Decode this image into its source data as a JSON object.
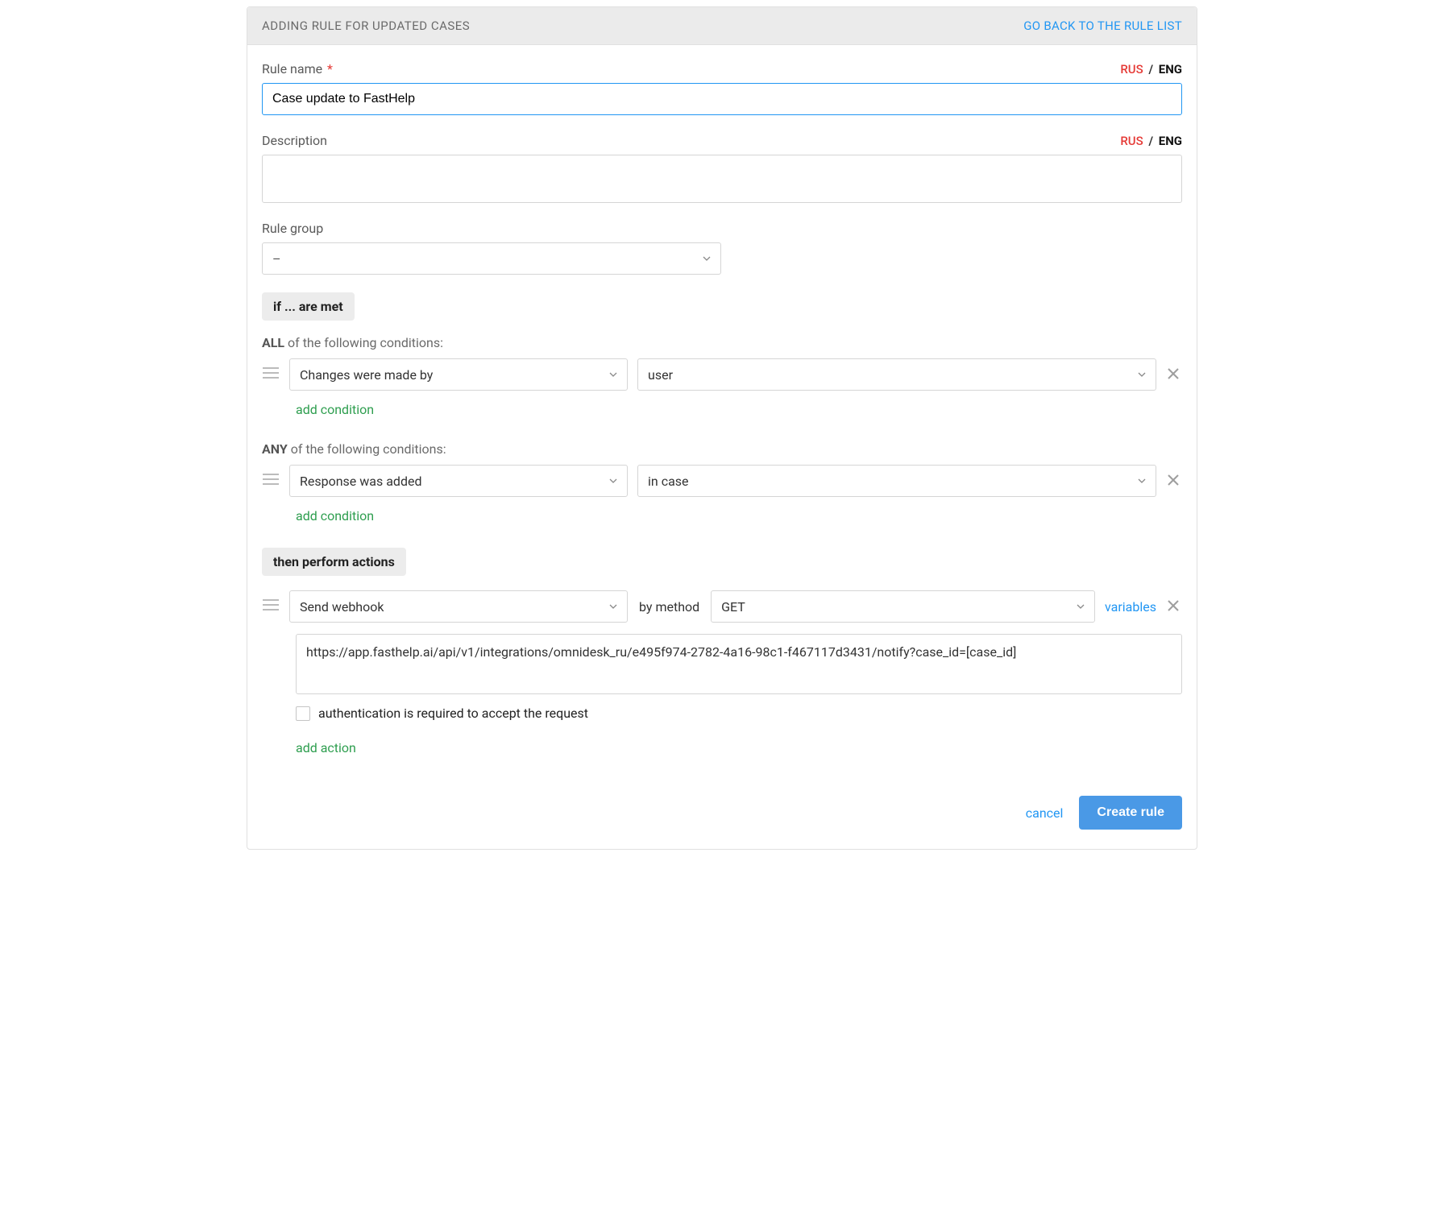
{
  "header": {
    "title": "ADDING RULE FOR UPDATED CASES",
    "back_link": "GO BACK TO THE RULE LIST"
  },
  "lang": {
    "rus": "RUS",
    "sep": "/",
    "eng": "ENG"
  },
  "fields": {
    "rule_name_label": "Rule name",
    "rule_name_value": "Case update to FastHelp",
    "description_label": "Description",
    "description_value": "",
    "rule_group_label": "Rule group",
    "rule_group_value": "–"
  },
  "sections": {
    "if_label": "if ... are met",
    "then_label": "then perform actions"
  },
  "conditions": {
    "all_prefix": "ALL",
    "all_suffix": " of the following conditions:",
    "any_prefix": "ANY",
    "any_suffix": " of the following conditions:",
    "all_rows": [
      {
        "left": "Changes were made by",
        "right": "user"
      }
    ],
    "any_rows": [
      {
        "left": "Response was added",
        "right": "in case"
      }
    ],
    "add_condition": "add condition"
  },
  "actions": {
    "rows": [
      {
        "action": "Send webhook",
        "by_method_label": "by method",
        "method": "GET",
        "variables_link": "variables",
        "url": "https://app.fasthelp.ai/api/v1/integrations/omnidesk_ru/e495f974-2782-4a16-98c1-f467117d3431/notify?case_id=[case_id]",
        "auth_required_label": "authentication is required to accept the request",
        "auth_required": false
      }
    ],
    "add_action": "add action"
  },
  "footer": {
    "cancel": "cancel",
    "create": "Create rule"
  }
}
